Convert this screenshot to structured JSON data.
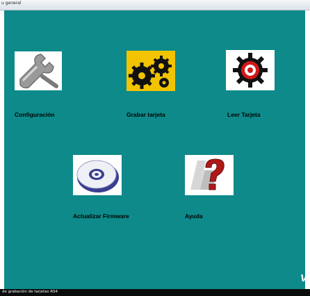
{
  "window": {
    "title": "u general"
  },
  "status_bar": {
    "text": "de grabación de tarjetas RS4"
  },
  "menu": [
    {
      "label": "Configuración",
      "icon": "wrench-icon"
    },
    {
      "label": "Grabar tarjeta",
      "icon": "gears-icon"
    },
    {
      "label": "Leer Tarjeta",
      "icon": "gear-eye-icon"
    },
    {
      "label": "Actualizar Firmware",
      "icon": "cd-disc-icon"
    },
    {
      "label": "Ayuda",
      "icon": "help-question-icon"
    }
  ],
  "corner_mark": "V",
  "colors": {
    "background": "#0e8a8a",
    "gears_yellow": "#f2c400",
    "gear_red": "#d01818",
    "help_red": "#b01818"
  }
}
